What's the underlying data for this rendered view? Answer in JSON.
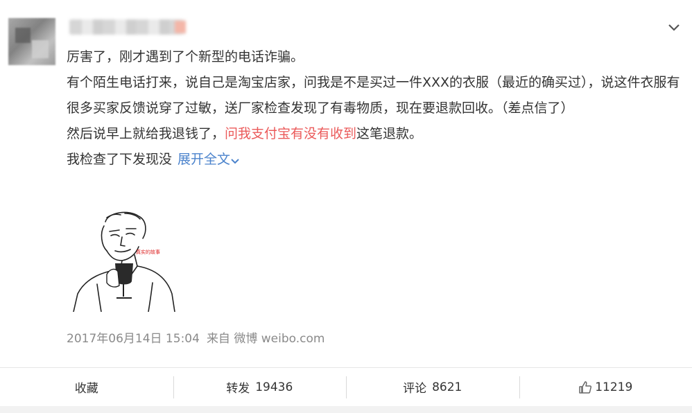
{
  "post": {
    "avatar_icon": "avatar-blurred",
    "username_masked": "",
    "more_icon": "chevron-down-icon",
    "lines": [
      "厉害了，刚才遇到了个新型的电话诈骗。",
      "有个陌生电话打来，说自己是淘宝店家，问我是不是买过一件XXX的衣服（最近的确买过），说这件衣服有很多买家反馈说穿了过敏，送厂家检查发现了有毒物质，现在要退款回收。（差点信了）"
    ],
    "line3_pre": "然后说早上就给我退钱了，",
    "line3_highlight": "问我支付宝有没有收到",
    "line3_post": "这笔退款。",
    "line4": "我检查了下发现没",
    "expand_label": "展开全文",
    "meme_caption": "真实的故事",
    "timestamp": "2017年06月14日 15:04",
    "source": "来自 微博 weibo.com"
  },
  "actions": {
    "favorite_label": "收藏",
    "repost_label": "转发",
    "repost_count": "19436",
    "comment_label": "评论",
    "comment_count": "8621",
    "like_count": "11219"
  },
  "colors": {
    "text": "#333333",
    "link": "#4b83cc",
    "highlight": "#eb5a5a",
    "meta": "#8a8a8a"
  }
}
